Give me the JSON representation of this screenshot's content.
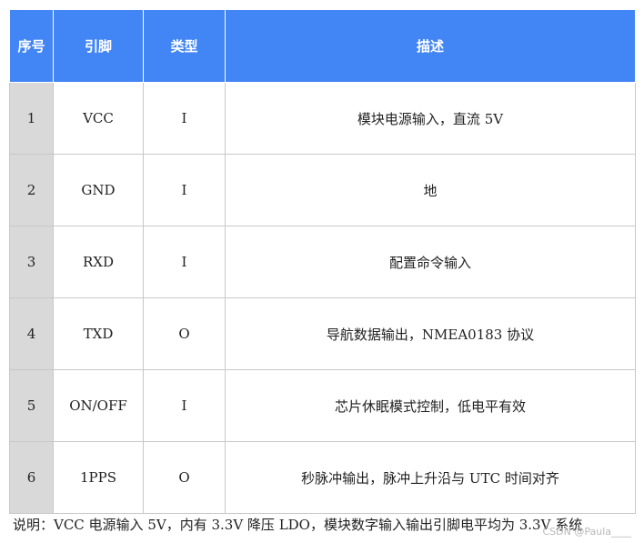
{
  "table": {
    "headers": [
      "序号",
      "引脚",
      "类型",
      "描述"
    ],
    "rows": [
      [
        "1",
        "VCC",
        "I",
        "模块电源输入，直流 5V"
      ],
      [
        "2",
        "GND",
        "I",
        "地"
      ],
      [
        "3",
        "RXD",
        "I",
        "配置命令输入"
      ],
      [
        "4",
        "TXD",
        "O",
        "导航数据输出，NMEA0183 协议"
      ],
      [
        "5",
        "ON/OFF",
        "I",
        "芯片休眠模式控制，低电平有效"
      ],
      [
        "6",
        "1PPS",
        "O",
        "秒脉冲输出，脉冲上升沿与 UTC 时间对齐"
      ]
    ]
  },
  "note": "说明：VCC 电源输入 5V，内有 3.3V 降压 LDO，模块数字输入输出引脚电平均为 3.3V 系统",
  "watermark": "CSDN @Paula____",
  "colors": {
    "header_bg": "#4285f4",
    "index_bg": "#d9d9d9",
    "border": "#c8c8c8"
  }
}
